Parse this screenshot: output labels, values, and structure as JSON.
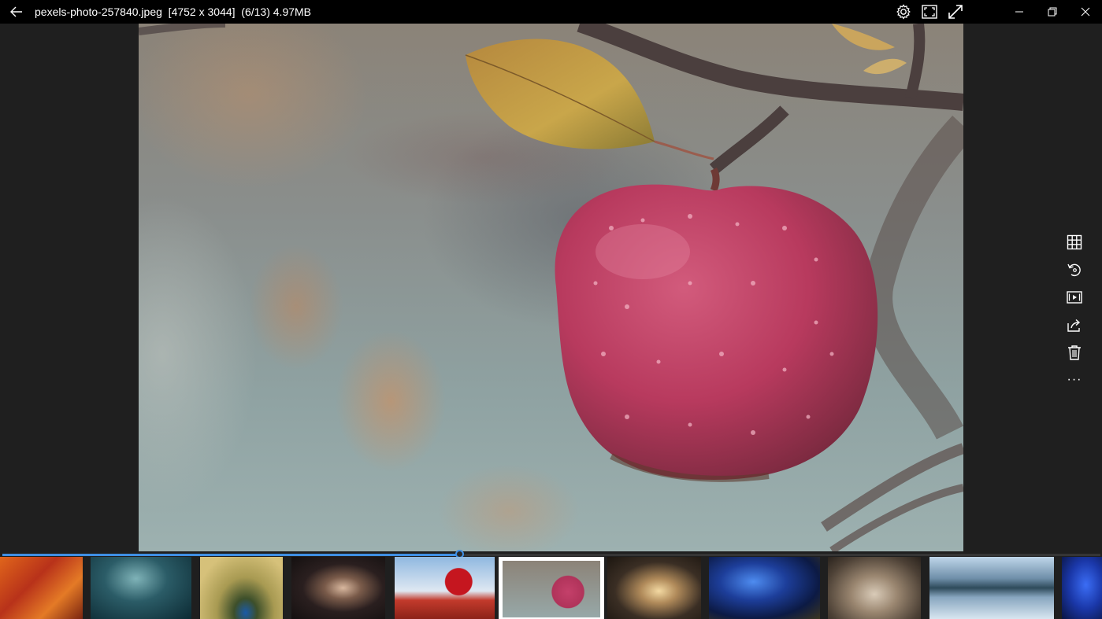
{
  "window": {
    "title": "pexels-photo-257840.jpeg  [4752 x 3044]  (6/13) 4.97MB"
  },
  "icons": {
    "back": "arrow-left-icon",
    "settings": "gear-icon",
    "fit": "fit-to-screen-icon",
    "fullscreen": "expand-diagonal-icon",
    "minimize": "minimize-icon",
    "restore": "restore-icon",
    "close": "close-icon"
  },
  "side_tools": {
    "grid": "grid-icon",
    "rotate": "rotate-icon",
    "slideshow": "slideshow-icon",
    "share": "share-icon",
    "delete": "trash-icon",
    "more_label": "···"
  },
  "gallery": {
    "current_index": 6,
    "total": 13,
    "position_fraction": 0.417
  },
  "accent_color": "#3f8fe4"
}
